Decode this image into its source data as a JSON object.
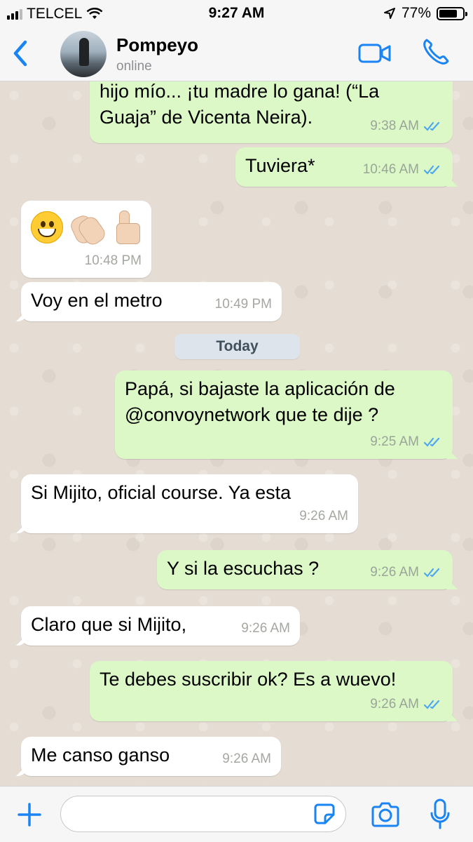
{
  "status_bar": {
    "carrier": "TELCEL",
    "time": "9:27 AM",
    "battery_percent": "77%",
    "battery_level": 0.77
  },
  "header": {
    "contact_name": "Pompeyo",
    "contact_status": "online",
    "icons": [
      "back-icon",
      "avatar",
      "video-call-icon",
      "phone-icon"
    ]
  },
  "chat": {
    "date_separator": "Today",
    "messages": [
      {
        "dir": "out",
        "lines": [
          "hijo mío...  ¡tu madre lo gana! (“La",
          "Guaja” de Vicenta Neira)."
        ],
        "time": "9:38 AM",
        "read": true
      },
      {
        "dir": "out",
        "lines": [
          "Tuviera*"
        ],
        "time": "10:46 AM",
        "read": true
      },
      {
        "dir": "in",
        "emoji": [
          "grinning-face",
          "clapping-hands",
          "thumbs-up"
        ],
        "time": "10:48 PM"
      },
      {
        "dir": "in",
        "lines": [
          "Voy en el metro"
        ],
        "time": "10:49 PM"
      },
      {
        "dir": "out",
        "lines": [
          "Papá, si bajaste la aplicación de",
          "@convoynetwork que te dije ?"
        ],
        "time": "9:25 AM",
        "read": true
      },
      {
        "dir": "in",
        "lines": [
          "Si Mijito, oficial course. Ya esta"
        ],
        "time": "9:26 AM"
      },
      {
        "dir": "out",
        "lines": [
          "Y si la escuchas ?"
        ],
        "time": "9:26 AM",
        "read": true
      },
      {
        "dir": "in",
        "lines": [
          "Claro que si Mijito,"
        ],
        "time": "9:26 AM"
      },
      {
        "dir": "out",
        "lines": [
          "Te debes suscribir ok? Es a wuevo!"
        ],
        "time": "9:26 AM",
        "read": true
      },
      {
        "dir": "in",
        "lines": [
          "Me canso ganso"
        ],
        "time": "9:26 AM"
      }
    ]
  },
  "composer": {
    "placeholder": "",
    "icons": [
      "plus-icon",
      "sticker-icon",
      "camera-icon",
      "microphone-icon"
    ]
  },
  "colors": {
    "accent": "#1a84f5",
    "outgoing_bubble": "#dcf8c6",
    "incoming_bubble": "#ffffff",
    "read_ticks": "#4fa7f0",
    "chat_background": "#e5ddd4"
  }
}
